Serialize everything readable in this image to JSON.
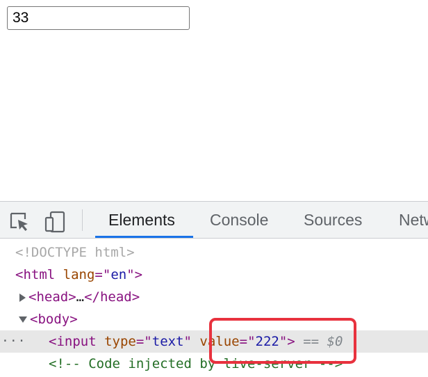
{
  "page": {
    "input_value": "33"
  },
  "devtools": {
    "toolbar": {
      "inspect_icon": "select-element-icon",
      "device_icon": "device-toolbar-icon"
    },
    "tabs": [
      {
        "label": "Elements",
        "active": true
      },
      {
        "label": "Console",
        "active": false
      },
      {
        "label": "Sources",
        "active": false
      },
      {
        "label": "Netw",
        "active": false
      }
    ],
    "dom": {
      "doctype": "<!DOCTYPE html>",
      "html_open": "<html",
      "html_attr_name": "lang",
      "html_attr_eq": "=\"",
      "html_attr_val": "en",
      "html_close": "\">",
      "head_open": "<head>",
      "head_ellipsis": "…",
      "head_close": "</head>",
      "body_open": "<body>",
      "gutter": "···",
      "input_open": "<input",
      "input_type_name": "type",
      "input_type_val": "text",
      "input_value_name": "value",
      "input_value_val": "222",
      "eq_quote": "=\"",
      "quote": "\"",
      "input_close": "\">",
      "selected_marker": "== $0",
      "comment": "<!-- Code injected by live-server -->"
    },
    "accent_color": "#1a73e8",
    "annotation_color": "#e8323e"
  }
}
